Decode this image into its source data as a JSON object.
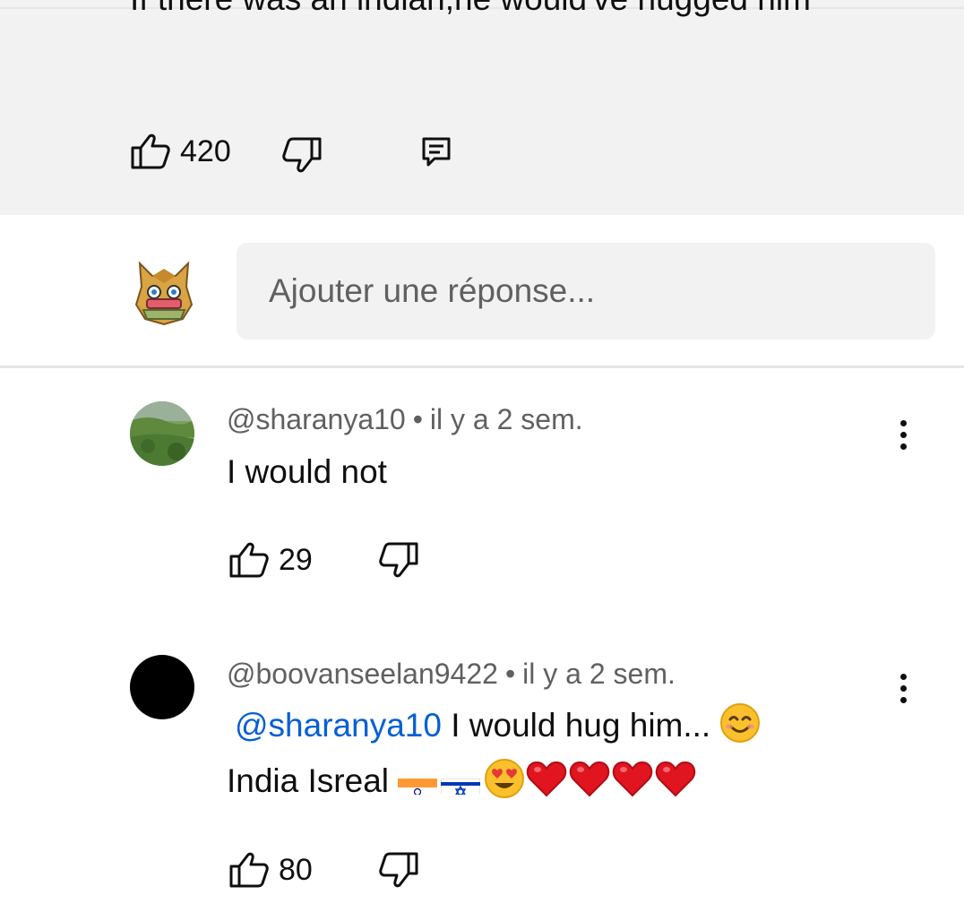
{
  "parent_comment": {
    "text": "If there was an indian,he would've hugged him",
    "like_count": "420",
    "icons": {
      "like": "thumb-up-icon",
      "dislike": "thumb-down-icon",
      "reply": "reply-icon"
    }
  },
  "composer": {
    "placeholder": "Ajouter une réponse..."
  },
  "replies": [
    {
      "author": "@sharanya10",
      "separator": "•",
      "time": "il y a 2 sem.",
      "text": "I would not",
      "like_count": "29"
    },
    {
      "author": "@boovanseelan9422",
      "separator": "•",
      "time": "il y a 2 sem.",
      "mention": "@sharanya10",
      "text_line1": "I would hug him...",
      "text_line2": "India Isreal",
      "emojis": [
        "india-flag",
        "israel-flag",
        "heart-eyes-emoji",
        "red-heart",
        "red-heart",
        "red-heart",
        "red-heart"
      ],
      "like_count": "80"
    }
  ],
  "colors": {
    "parent_bg": "#f2f2f2",
    "mention": "#065fd4",
    "secondary_text": "#606060"
  }
}
